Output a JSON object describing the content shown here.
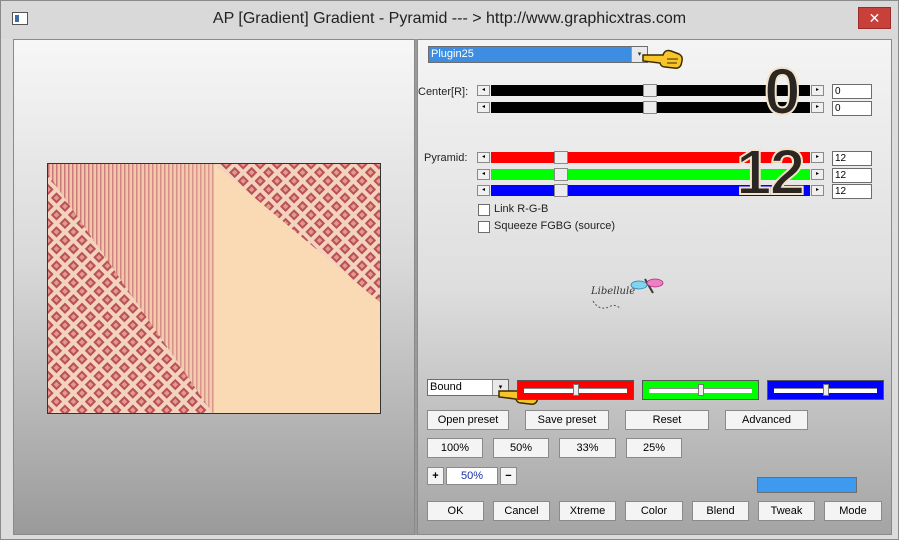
{
  "window": {
    "title": "AP [Gradient]  Gradient - Pyramid     --- > http://www.graphicxtras.com",
    "close_glyph": "✕"
  },
  "plugin_select": {
    "value": "Plugin25"
  },
  "center": {
    "label": "Center[R]:",
    "values": [
      "0",
      "0"
    ],
    "overlay_digit": "0"
  },
  "pyramid": {
    "label": "Pyramid:",
    "values": [
      "12",
      "12",
      "12"
    ],
    "overlay_digit": "12",
    "channel_colors": [
      "#ff0000",
      "#00ff00",
      "#0000ff"
    ]
  },
  "options": {
    "link_rgb": "Link R-G-B",
    "squeeze": "Squeeze FGBG (source)"
  },
  "watermark": "Libellule",
  "mode_select": {
    "value": "Bound"
  },
  "swatches": [
    {
      "color": "#ff0000",
      "level": 0.5
    },
    {
      "color": "#00ff00",
      "level": 0.5
    },
    {
      "color": "#0000ff",
      "level": 0.5
    }
  ],
  "preset_buttons": [
    "Open preset",
    "Save preset",
    "Reset",
    "Advanced"
  ],
  "zoom_buttons": [
    "100%",
    "50%",
    "33%",
    "25%"
  ],
  "zoom": {
    "plus": "+",
    "value": "50%",
    "minus": "−"
  },
  "footer_buttons": [
    "OK",
    "Cancel",
    "Xtreme",
    "Color",
    "Blend",
    "Tweak",
    "Mode"
  ],
  "icons": {
    "arrow_left": "◂",
    "arrow_right": "▸",
    "arrow_down": "▾"
  }
}
